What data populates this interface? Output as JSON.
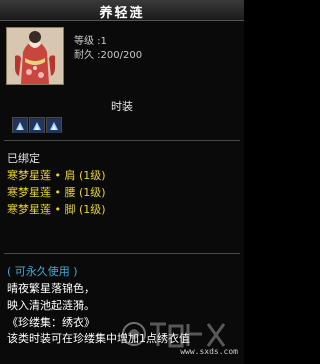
{
  "item": {
    "name": "养轻涟",
    "level_text": "等级 :1",
    "durability_text": "耐久 :200/200",
    "category": "时装"
  },
  "gems": {
    "icon": "blue-crystal-icon",
    "count": 3
  },
  "binding": {
    "status": "已绑定",
    "set_pieces": [
      "寒梦星莲 • 肩 (1级)",
      "寒梦星莲 • 腰 (1级)",
      "寒梦星莲 • 脚 (1级)"
    ]
  },
  "usage": {
    "label": "( 可永久使用 )",
    "description_lines": [
      "晴夜繁星落锦色，",
      "映入清池起涟漪。",
      "《珍缕集：绣衣》"
    ],
    "note": "该类时装可在珍缕集中增加1点绣衣值"
  },
  "watermark": {
    "text": "www.sxds.com"
  },
  "colors": {
    "title": "#ffffff",
    "set_text": "#e8d23a",
    "usable": "#3fa9d8",
    "stat": "#c8c8c8"
  }
}
